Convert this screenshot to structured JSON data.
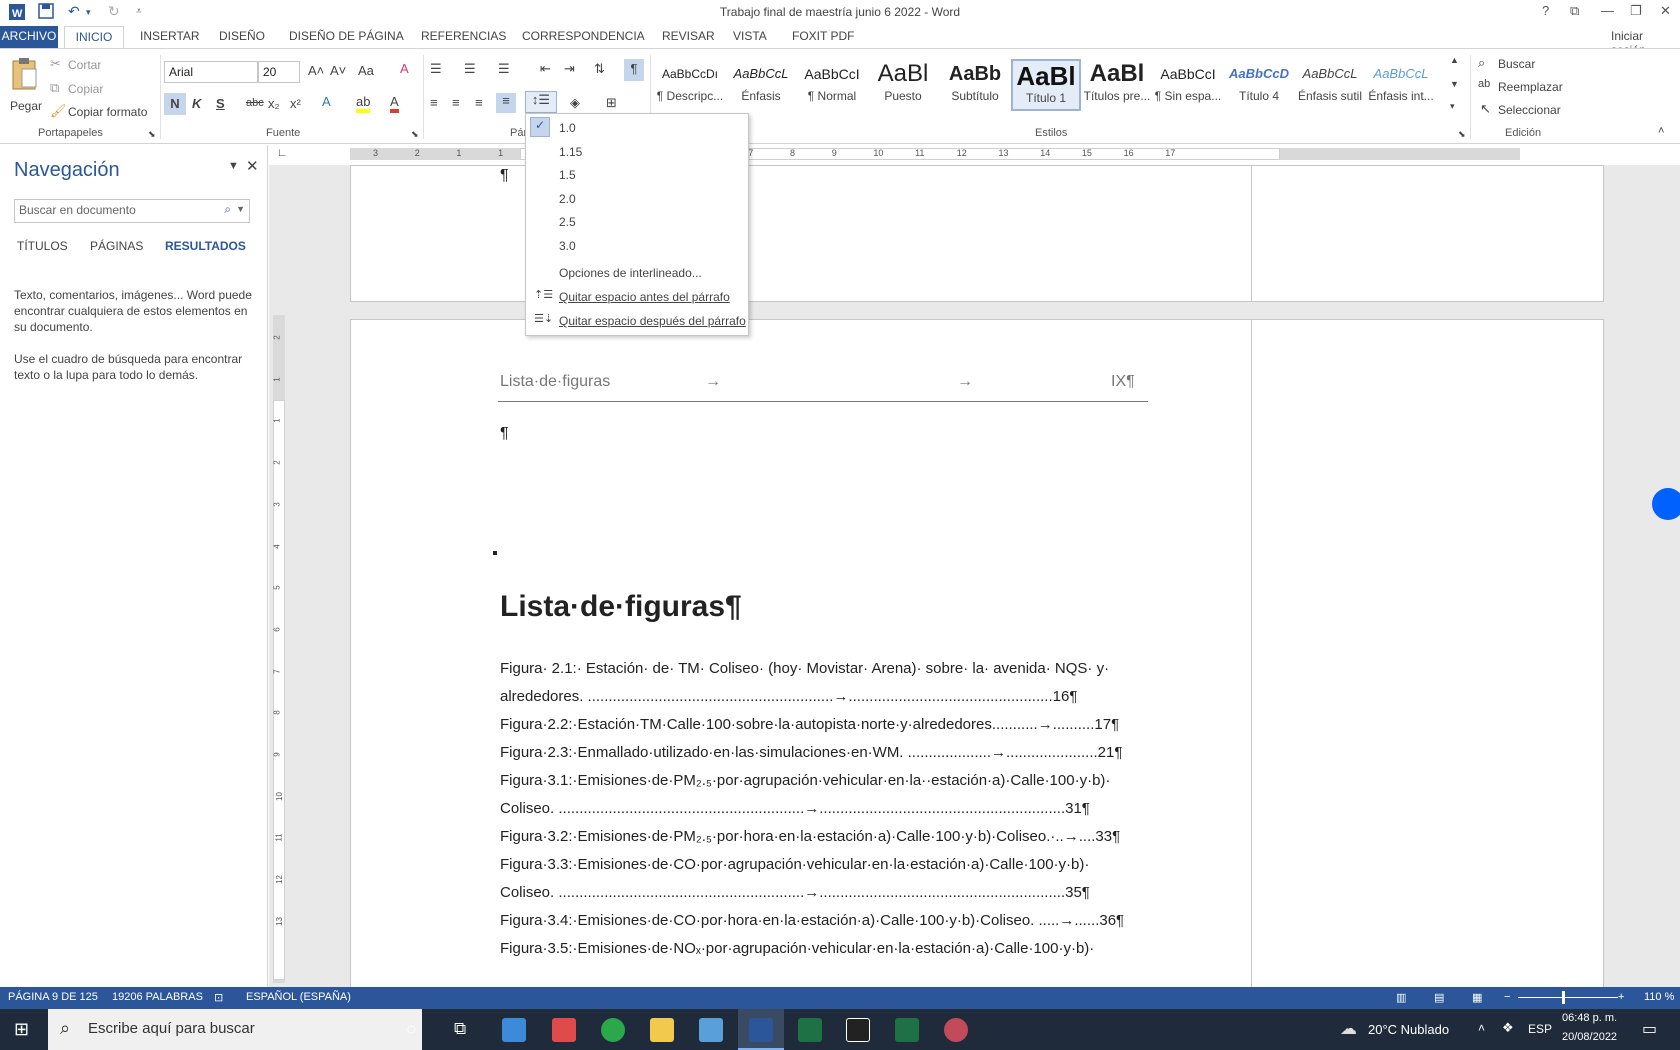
{
  "window": {
    "title": "Trabajo final de maestría junio 6 2022 - Word",
    "help": "?",
    "signin": "Iniciar sesión"
  },
  "tabs": [
    "ARCHIVO",
    "INICIO",
    "INSERTAR",
    "DISEÑO",
    "DISEÑO DE PÁGINA",
    "REFERENCIAS",
    "CORRESPONDENCIA",
    "REVISAR",
    "VISTA",
    "FOXIT PDF"
  ],
  "clipboard": {
    "paste": "Pegar",
    "cut": "Cortar",
    "copy": "Copiar",
    "format_painter": "Copiar formato",
    "group": "Portapapeles"
  },
  "font": {
    "family": "Arial",
    "size": "20",
    "bold": "N",
    "italic": "K",
    "underline": "S",
    "strike": "abc",
    "sub": "x₂",
    "sup": "x²",
    "group": "Fuente",
    "case": "Aa"
  },
  "paragraph": {
    "group": "Pár"
  },
  "styles": {
    "group": "Estilos",
    "items": [
      {
        "preview": "AaBbCcDı",
        "name": "¶ Descripc..."
      },
      {
        "preview": "AaBbCcL",
        "name": "Énfasis"
      },
      {
        "preview": "AaBbCcI",
        "name": "¶ Normal"
      },
      {
        "preview": "AaBl",
        "name": "Puesto"
      },
      {
        "preview": "AaBb",
        "name": "Subtítulo"
      },
      {
        "preview": "AaBl",
        "name": "Título 1"
      },
      {
        "preview": "AaBl",
        "name": "Títulos pre..."
      },
      {
        "preview": "AaBbCcI",
        "name": "¶ Sin espa..."
      },
      {
        "preview": "AaBbCcD",
        "name": "Título 4"
      },
      {
        "preview": "AaBbCcL",
        "name": "Énfasis sutil"
      },
      {
        "preview": "AaBbCcL",
        "name": "Énfasis int..."
      }
    ]
  },
  "editing": {
    "find": "Buscar",
    "replace": "Reemplazar",
    "select": "Seleccionar",
    "group": "Edición"
  },
  "spacing_menu": {
    "options": [
      "1.0",
      "1.15",
      "1.5",
      "2.0",
      "2.5",
      "3.0"
    ],
    "selected": "1.0",
    "more": "Opciones de interlineado...",
    "remove_before": "Quitar espacio antes del párrafo",
    "remove_after": "Quitar espacio después del párrafo"
  },
  "navigation": {
    "title": "Navegación",
    "search_placeholder": "Buscar en documento",
    "tabs": [
      "TÍTULOS",
      "PÁGINAS",
      "RESULTADOS"
    ],
    "active_tab": "RESULTADOS",
    "help1": "Texto, comentarios, imágenes... Word puede encontrar cualquiera de estos elementos en su documento.",
    "help2": "Use el cuadro de búsqueda para encontrar texto o la lupa para todo lo demás."
  },
  "ruler": {
    "h_ticks": [
      "3",
      "2",
      "1",
      "1",
      "2",
      "3",
      "4",
      "5",
      "6",
      "7",
      "8",
      "9",
      "10",
      "11",
      "12",
      "13",
      "14",
      "15",
      "16",
      "17"
    ],
    "v_ticks": [
      "2",
      "1",
      "1",
      "2",
      "3",
      "4",
      "5",
      "6",
      "7",
      "8",
      "9",
      "10",
      "11",
      "12",
      "13"
    ]
  },
  "document": {
    "pilcrow": "¶",
    "header_left": "Lista·de·figuras",
    "header_tab1": "→",
    "header_tab2": "→",
    "header_right": "IX¶",
    "heading": "Lista·de·figuras¶",
    "lines": [
      "Figura· 2.1:· Estación· de· TM· Coliseo· (hoy· Movistar· Arena)· sobre· la· avenida· NQS· y·",
      "alrededores. ...........................................................→.................................................16¶",
      "Figura·2.2:·Estación·TM·Calle·100·sobre·la·autopista·norte·y·alrededores...........→..........17¶",
      "Figura·2.3:·Enmallado·utilizado·en·las·simulaciones·en·WM. ....................→......................21¶",
      "Figura·3.1:·Emisiones·de·PM₂.₅·por·agrupación·vehicular·en·la··estación·a)·Calle·100·y·b)·",
      "Coliseo. ...........................................................→...........................................................31¶",
      "Figura·3.2:·Emisiones·de·PM₂.₅·por·hora·en·la·estación·a)·Calle·100·y·b)·Coliseo.·..→....33¶",
      "Figura·3.3:·Emisiones·de·CO·por·agrupación·vehicular·en·la·estación·a)·Calle·100·y·b)·",
      "Coliseo. ...........................................................→...........................................................35¶",
      "Figura·3.4:·Emisiones·de·CO·por·hora·en·la·estación·a)·Calle·100·y·b)·Coliseo. .....→......36¶",
      "Figura·3.5:·Emisiones·de·NOₓ·por·agrupación·vehicular·en·la·estación·a)·Calle·100·y·b)·"
    ]
  },
  "status": {
    "page": "PÁGINA 9 DE 125",
    "words": "19206 PALABRAS",
    "language": "ESPAÑOL (ESPAÑA)",
    "zoom": "110 %"
  },
  "taskbar": {
    "search_placeholder": "Escribe aquí para buscar",
    "weather": "20°C  Nublado",
    "lang": "ESP",
    "time": "06:48 p. m.",
    "date": "20/08/2022"
  },
  "colors": {
    "accent": "#2b579a",
    "taskbar": "#1f2a3a"
  }
}
